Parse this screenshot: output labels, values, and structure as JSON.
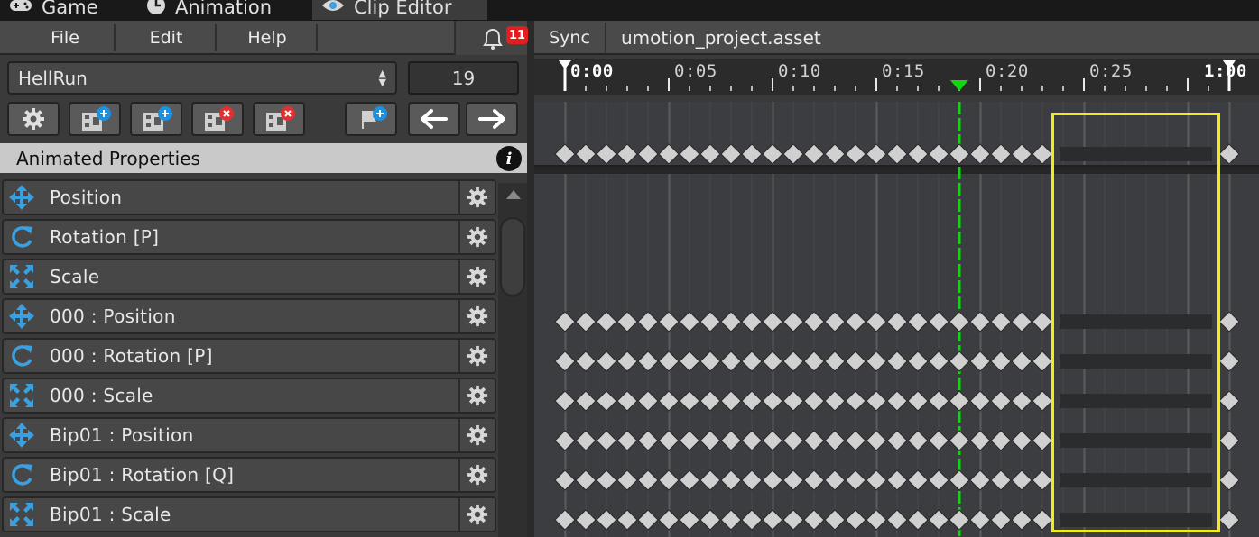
{
  "tabs": [
    {
      "label": "Game",
      "icon": "gamepad-icon",
      "active": false
    },
    {
      "label": "Animation",
      "icon": "clock-icon",
      "active": false
    },
    {
      "label": "Clip Editor",
      "icon": "eye-icon",
      "active": true
    }
  ],
  "menu": {
    "file": "File",
    "edit": "Edit",
    "help": "Help",
    "notification_count": "11"
  },
  "clip": {
    "selected": "HellRun",
    "frame": "19"
  },
  "toolbar": {
    "icons": [
      "gear-icon",
      "add-clip-icon",
      "add-clip-icon",
      "delete-clip-icon",
      "delete-clip-icon",
      "add-event-icon",
      "arrow-left-icon",
      "arrow-right-icon"
    ]
  },
  "section": {
    "title": "Animated Properties"
  },
  "properties": [
    {
      "label": "Position",
      "icon": "move-icon"
    },
    {
      "label": "Rotation [P]",
      "icon": "rotate-icon"
    },
    {
      "label": "Scale",
      "icon": "scale-icon"
    },
    {
      "label": "000 : Position",
      "icon": "move-icon"
    },
    {
      "label": "000 : Rotation [P]",
      "icon": "rotate-icon"
    },
    {
      "label": "000 : Scale",
      "icon": "scale-icon"
    },
    {
      "label": "Bip01 : Position",
      "icon": "move-icon"
    },
    {
      "label": "Bip01 : Rotation [Q]",
      "icon": "rotate-icon"
    },
    {
      "label": "Bip01 : Scale",
      "icon": "scale-icon"
    }
  ],
  "timeline": {
    "sync_label": "Sync",
    "file_name": "umotion_project.asset",
    "labels": [
      "0:00",
      "0:05",
      "0:10",
      "0:15",
      "0:20",
      "0:25",
      "1:00"
    ],
    "total_frames": 32,
    "current_frame": 19,
    "keyframe_frames_visible": 24,
    "selection_start_frame": 24,
    "selection_end_frame": 31
  },
  "colors": {
    "playhead": "#11d611",
    "selection": "#f2ea1a",
    "icon_blue": "#3aa0e0",
    "keyframe": "#d0d0d0"
  }
}
